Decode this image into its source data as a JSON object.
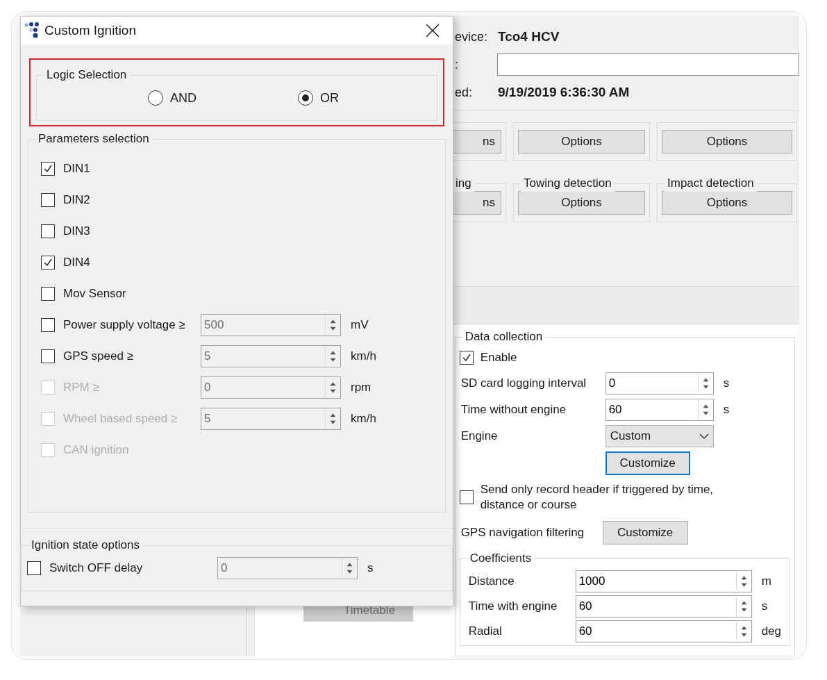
{
  "dialog": {
    "title": "Custom Ignition",
    "logic_selection": {
      "title": "Logic Selection",
      "options": [
        {
          "label": "AND",
          "selected": false
        },
        {
          "label": "OR",
          "selected": true
        }
      ]
    },
    "parameters_selection": {
      "title": "Parameters selection",
      "items": [
        {
          "kind": "plain",
          "label": "DIN1",
          "checked": true,
          "disabled": false
        },
        {
          "kind": "plain",
          "label": "DIN2",
          "checked": false,
          "disabled": false
        },
        {
          "kind": "plain",
          "label": "DIN3",
          "checked": false,
          "disabled": false
        },
        {
          "kind": "plain",
          "label": "DIN4",
          "checked": true,
          "disabled": false
        },
        {
          "kind": "plain",
          "label": "Mov Sensor",
          "checked": false,
          "disabled": false
        },
        {
          "kind": "numeric",
          "label": "Power supply voltage ≥",
          "checked": false,
          "disabled": false,
          "value": "500",
          "unit": "mV"
        },
        {
          "kind": "numeric",
          "label": "GPS speed ≥",
          "checked": false,
          "disabled": false,
          "value": "5",
          "unit": "km/h"
        },
        {
          "kind": "numeric",
          "label": "RPM ≥",
          "checked": false,
          "disabled": true,
          "value": "0",
          "unit": "rpm"
        },
        {
          "kind": "numeric",
          "label": "Wheel based speed ≥",
          "checked": false,
          "disabled": true,
          "value": "5",
          "unit": "km/h"
        },
        {
          "kind": "plain",
          "label": "CAN ignition",
          "checked": false,
          "disabled": true
        }
      ]
    },
    "ignition_state_options": {
      "title": "Ignition state options",
      "label": "Switch OFF delay",
      "checked": false,
      "value": "0",
      "unit": "s"
    }
  },
  "background_window": {
    "info": [
      {
        "label": "evice:",
        "value": "Tco4 HCV",
        "kind": "text"
      },
      {
        "label": ":",
        "kind": "field"
      },
      {
        "label": "ed:",
        "value": "9/19/2019 6:36:30 AM",
        "kind": "text"
      }
    ],
    "feature_groups": [
      {
        "button": "ns"
      },
      {
        "button": "Options"
      },
      {
        "button": "Options"
      },
      {
        "title": "ing",
        "button": "ns"
      },
      {
        "title": "Towing detection",
        "button": "Options"
      },
      {
        "title": "Impact detection",
        "button": "Options"
      }
    ],
    "timetable_button": "Timetable",
    "data_collection": {
      "title": "Data collection",
      "enable": {
        "label": "Enable",
        "checked": true
      },
      "fields": [
        {
          "label": "SD card logging interval",
          "value": "0",
          "unit": "s"
        },
        {
          "label": "Time without engine",
          "value": "60",
          "unit": "s"
        }
      ],
      "engine": {
        "label": "Engine",
        "value": "Custom",
        "button": "Customize"
      },
      "header_only": {
        "label": "Send only record header if triggered by time, distance or course",
        "checked": false
      },
      "gps_filtering": {
        "label": "GPS navigation filtering",
        "button": "Customize"
      },
      "coefficients": {
        "title": "Coefficients",
        "fields": [
          {
            "label": "Distance",
            "value": "1000",
            "unit": "m"
          },
          {
            "label": "Time with engine",
            "value": "60",
            "unit": "s"
          },
          {
            "label": "Radial",
            "value": "60",
            "unit": "deg"
          }
        ]
      }
    }
  }
}
